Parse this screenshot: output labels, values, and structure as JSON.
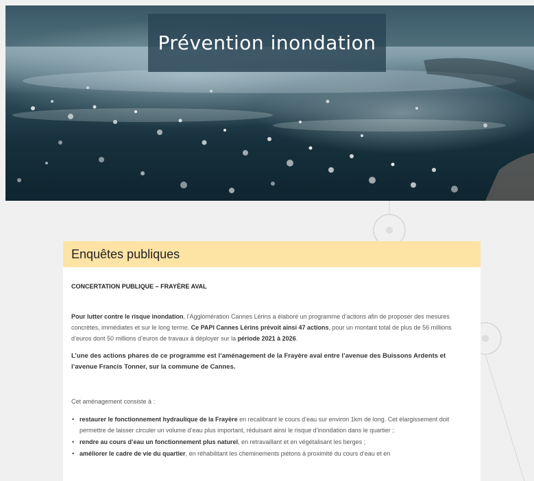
{
  "hero": {
    "title": "Prévention inondation"
  },
  "card": {
    "header": "Enquêtes publiques",
    "section_title": "CONCERTATION PUBLIQUE – FRAYÈRE AVAL",
    "para1": {
      "b1": "Pour lutter contre le risque inondation",
      "t1": ", l’Agglomération Cannes Lérins a élaboré un programme d’actions afin de proposer des mesures concrètes, immédiates et sur le long terme. ",
      "b2": "Ce PAPI Cannes Lérins prévoit ainsi 47 actions",
      "t2": ", pour un montant total de plus de 56 millions d’euros dont 50 millions d’euros de travaux à déployer sur la ",
      "b3": "période 2021 à 2026",
      "t3": "."
    },
    "para2": "L’une des actions phares de ce programme est l’aménagement de la Frayère aval entre l’avenue des Buissons Ardents et l’avenue Francis Tonner, sur la commune de Cannes.",
    "intro_list": "Cet aménagement consiste à :",
    "items": [
      {
        "bold": "restaurer le fonctionnement hydraulique de la Frayère",
        "text": " en recalibrant le cours d’eau sur environ 1km de long. Cet élargissement doit permettre de laisser circuler un volume d’eau plus important, réduisant ainsi le risque d’inondation dans le quartier ;"
      },
      {
        "bold": "rendre au cours d’eau un fonctionnement plus naturel",
        "text": ", en retravaillant et en végétalisant les berges ;"
      },
      {
        "bold": "améliorer le cadre de vie du quartier",
        "text": ", en réhabilitant les cheminements piétons à proximité du cours d’eau et en"
      }
    ]
  }
}
